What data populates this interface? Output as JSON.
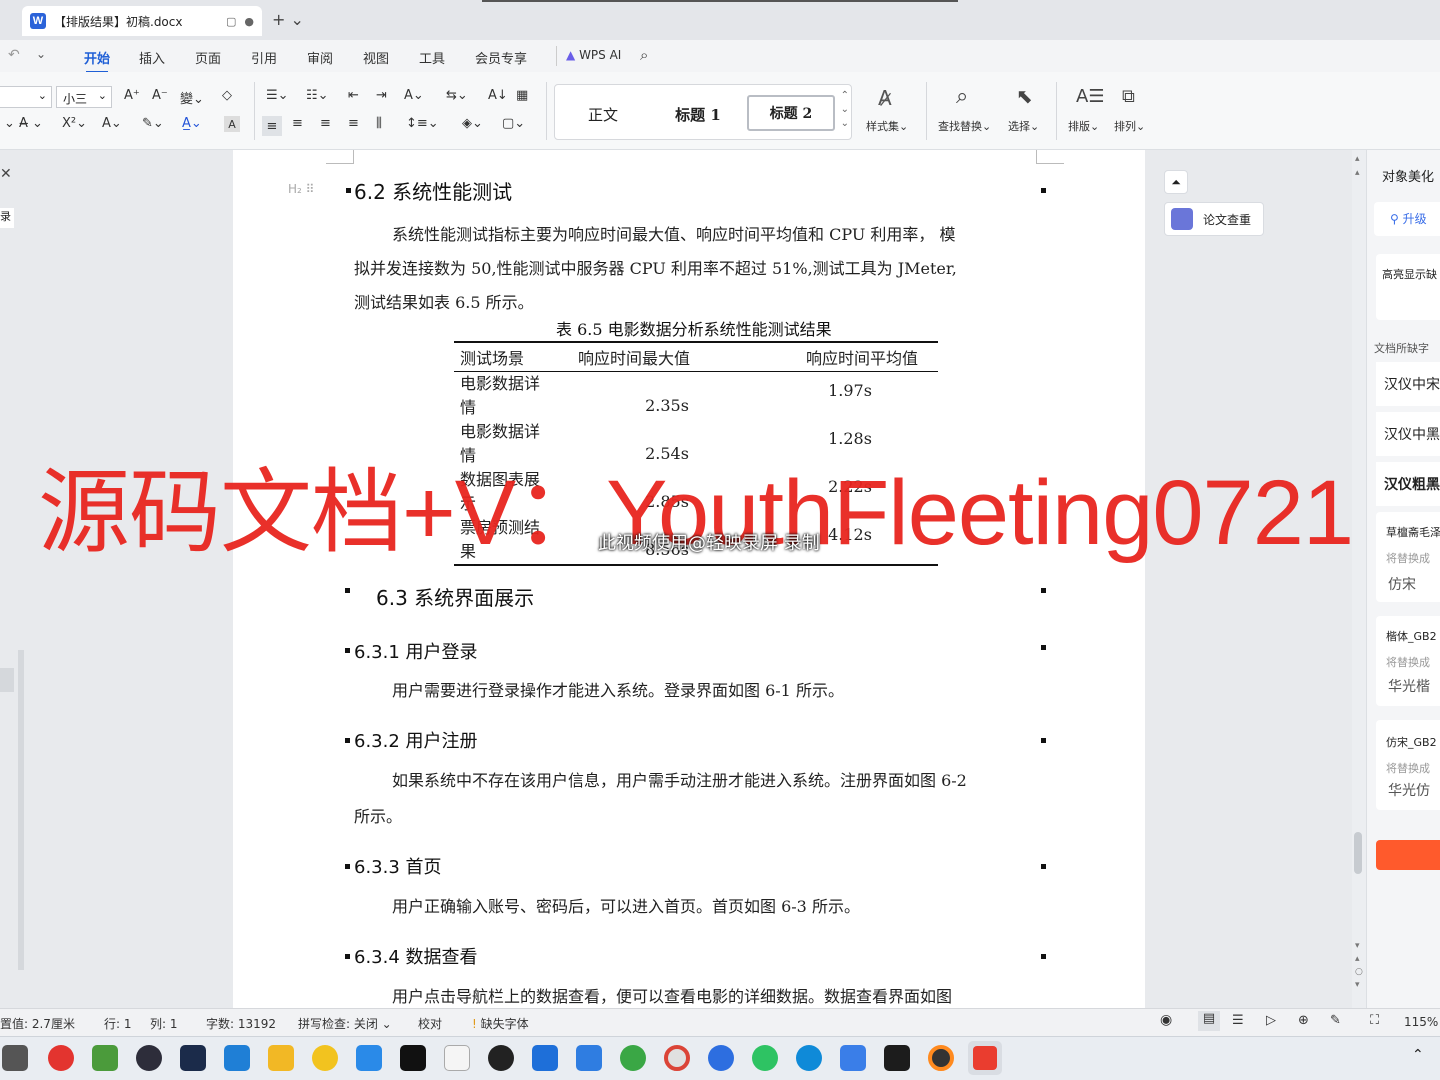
{
  "titlebar": {
    "doc_tab": "【排版结果】初稿.docx",
    "app_letter": "W"
  },
  "menu": [
    "开始",
    "插入",
    "页面",
    "引用",
    "审阅",
    "视图",
    "工具",
    "会员专享"
  ],
  "wps_ai": "WPS AI",
  "toolbar": {
    "font_size": "小三",
    "styles": [
      "正文",
      "标题 1",
      "标题 2"
    ],
    "style_set": "样式集",
    "find_replace": "查找替换",
    "select": "选择",
    "arrange": "排版",
    "align_order": "排列"
  },
  "document": {
    "h62": "6.2  系统性能测试",
    "p1_line1": "系统性能测试指标主要为响应时间最大值、响应时间平均值和 CPU  利用率，  模",
    "p1_line2": "拟并发连接数为 50,性能测试中服务器  CPU  利用率不超过 51%,测试工具为  JMeter,",
    "p1_line3": "测试结果如表 6.5 所示。",
    "table_caption": "表 6.5  电影数据分析系统性能测试结果",
    "table_headers": [
      "测试场景",
      "响应时间最大值",
      "响应时间平均值"
    ],
    "table_rows": [
      {
        "scene1": "电影数据详",
        "scene2": "情",
        "max": "2.35s",
        "avg": "1.97s"
      },
      {
        "scene1": "电影数据详",
        "scene2": "情",
        "max": "2.54s",
        "avg": "1.28s"
      },
      {
        "scene1": "数据图表展",
        "scene2": "示",
        "max": "2.85s",
        "avg": "2.22s"
      },
      {
        "scene1": "票房预测结",
        "scene2": "果",
        "max": "8.56s",
        "avg": "4.12s"
      }
    ],
    "h63": "6.3  系统界面展示",
    "h631": "6.3.1  用户登录",
    "p631": "用户需要进行登录操作才能进入系统。登录界面如图 6-1 所示。",
    "h632": "6.3.2  用户注册",
    "p632_line1": "如果系统中不存在该用户信息，用户需手动注册才能进入系统。注册界面如图 6-2",
    "p632_line2": "所示。",
    "h633": "6.3.3  首页",
    "p633": "用户正确输入账号、密码后，可以进入首页。首页如图 6-3 所示。",
    "h634": "6.3.4  数据查看",
    "p634": "用户点击导航栏上的数据查看，便可以查看电影的详细数据。数据查看界面如图"
  },
  "watermark": "源码文档+V：YouthFleeting0721",
  "record_note": "此视频使用@轻映录屏 录制",
  "side": {
    "paper_check": "论文查重",
    "panel_title": "对象美化",
    "upgrade": "升级",
    "highlight": "高亮显示缺",
    "missing_fonts": "文档所缺字",
    "font1": "汉仪中宋",
    "font2": "汉仪中黑",
    "font3": "汉仪粗黑",
    "card1_title": "草檀斋毛泽",
    "card1_sub": "将替换成",
    "card1_font": "仿宋",
    "card2_title": "楷体_GB2",
    "card2_sub": "将替换成",
    "card2_font": "华光楷",
    "card3_title": "仿宋_GB2",
    "card3_sub": "将替换成",
    "card3_font": "华光仿"
  },
  "status": {
    "position": "置值: 2.7厘米",
    "row": "行: 1",
    "col": "列: 1",
    "words": "字数: 13192",
    "spell": "拼写检查: 关闭",
    "proof": "校对",
    "missing": "缺失字体",
    "zoom": "115%"
  },
  "colors": {
    "accent": "#1f5fd6",
    "watermark": "#e8251f",
    "orange_btn": "#ff5a2c"
  }
}
